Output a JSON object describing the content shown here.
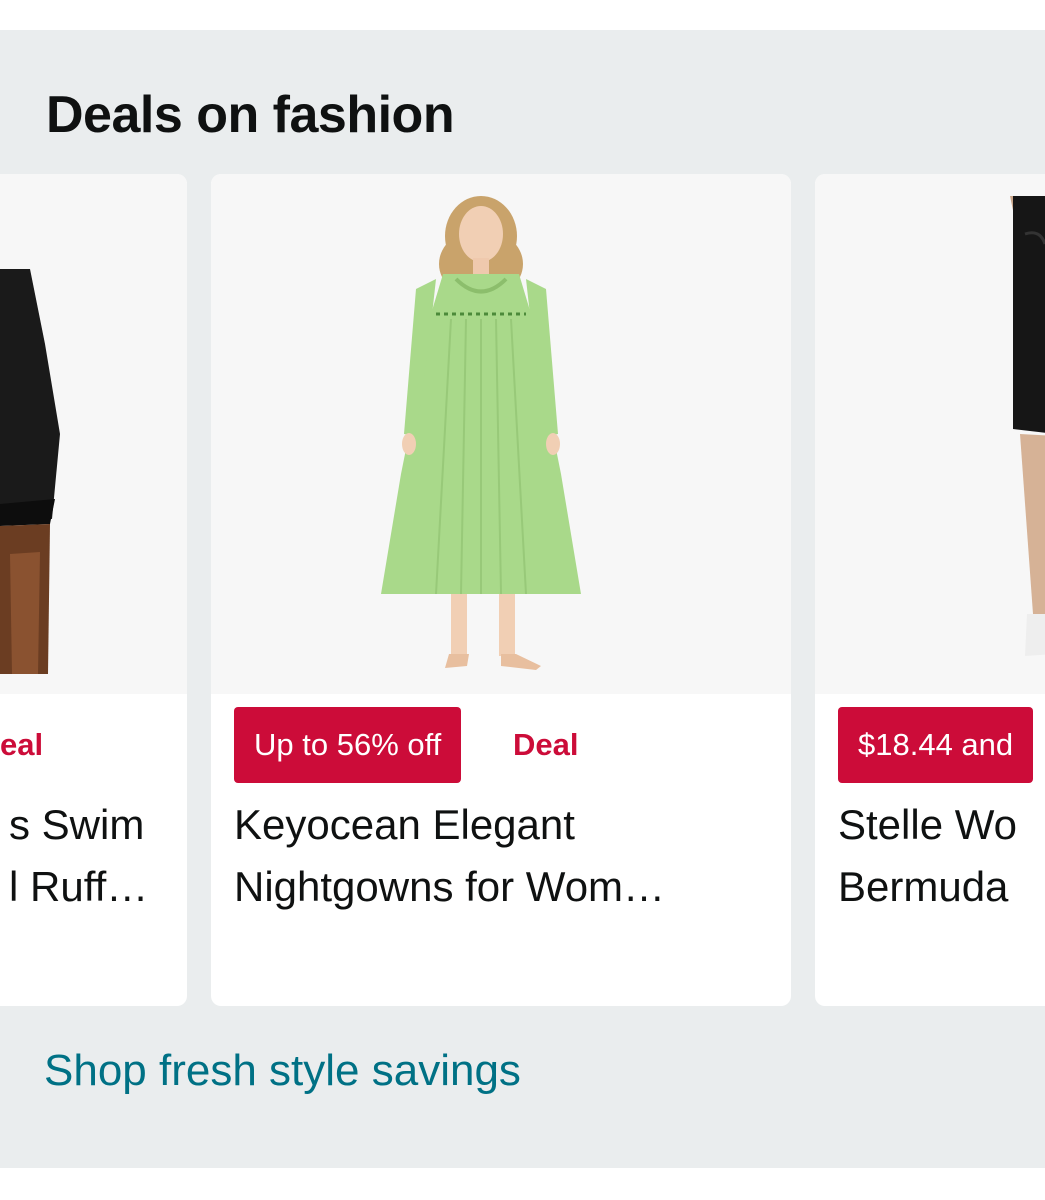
{
  "section": {
    "title": "Deals on fashion",
    "footer_link": "Shop fresh style savings"
  },
  "cards": [
    {
      "deal_label": "Deal",
      "title_line1": "Women's Swim",
      "title_line2": "Skort Ruff…",
      "title_visible_line1": "s Swim",
      "title_visible_line2": "l Ruff…",
      "deal_visible": "eal"
    },
    {
      "badge": "Up to 56% off",
      "deal_label": "Deal",
      "title_line1": "Keyocean Elegant",
      "title_line2": "Nightgowns for Wom…",
      "image_icon": "green-nightgown-model-image"
    },
    {
      "badge": "$18.44 and",
      "title_line1": "Stelle Wo",
      "title_line2": "Bermuda",
      "image_icon": "black-shorts-model-image"
    }
  ],
  "colors": {
    "panel_bg": "#eaedee",
    "deal_red": "#cc0c39",
    "link_teal": "#007185",
    "text": "#0f1111"
  }
}
